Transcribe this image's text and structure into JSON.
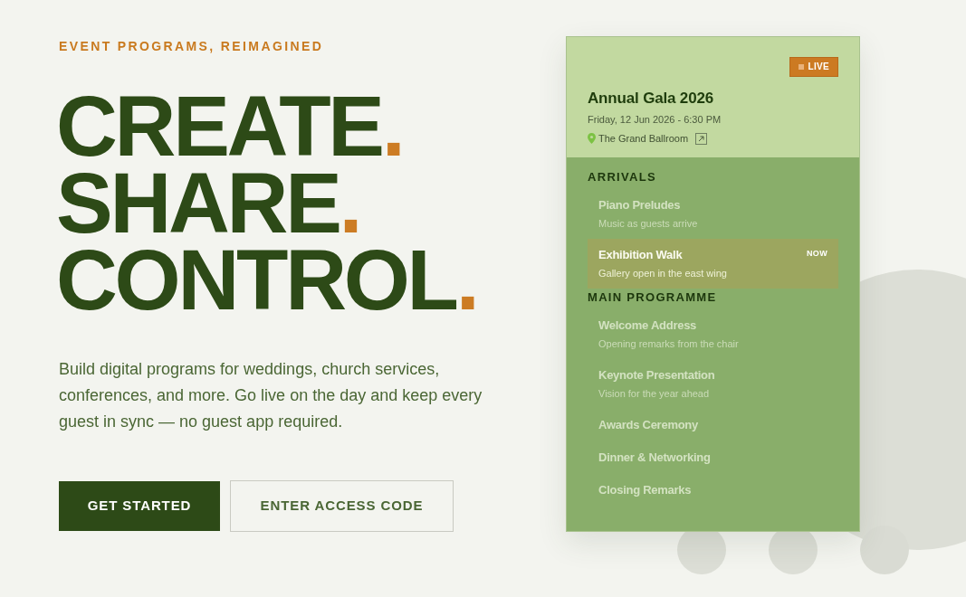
{
  "hero": {
    "eyebrow": "EVENT PROGRAMS, REIMAGINED",
    "headline": [
      {
        "word": "CREATE",
        "mark": "."
      },
      {
        "word": "SHARE",
        "mark": "."
      },
      {
        "word": "CONTROL",
        "mark": "."
      }
    ],
    "description": "Build digital programs for weddings, church services, conferences, and more. Go live on the day and keep every guest in sync — no guest app required.",
    "buttons": [
      {
        "label": "GET STARTED",
        "kind": "primary"
      },
      {
        "label": "ENTER ACCESS CODE",
        "kind": "secondary"
      }
    ]
  },
  "preview_card": {
    "badge": {
      "label": "LIVE"
    },
    "title": "Annual Gala 2026",
    "datetime": "Friday, 12 Jun 2026 - 6:30 PM",
    "location": "The Grand Ballroom",
    "sections": [
      {
        "heading": "ARRIVALS",
        "items": [
          {
            "title": "Piano Preludes",
            "subtitle": "Music as guests arrive",
            "selected": false
          },
          {
            "title": "Exhibition Walk",
            "subtitle": "Gallery open in the east wing",
            "selected": true,
            "tag": "NOW"
          }
        ]
      },
      {
        "heading": "MAIN PROGRAMME",
        "items": [
          {
            "title": "Welcome Address",
            "subtitle": "Opening remarks from the chair",
            "selected": false
          },
          {
            "title": "Keynote Presentation",
            "subtitle": "Vision for the year ahead",
            "selected": false
          },
          {
            "title": "Awards Ceremony",
            "selected": false
          },
          {
            "title": "Dinner & Networking",
            "selected": false
          },
          {
            "title": "Closing Remarks",
            "selected": false
          }
        ]
      }
    ]
  }
}
